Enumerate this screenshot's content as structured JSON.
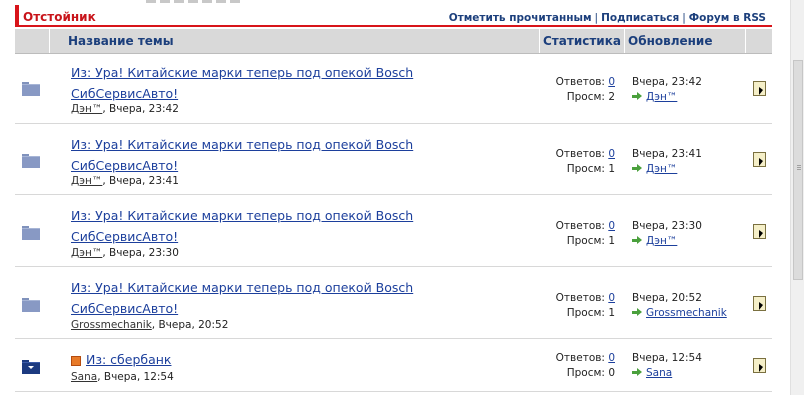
{
  "header": {
    "forum_title": "Отстойник",
    "links": [
      "Отметить прочитанным",
      "Подписаться",
      "Форум в RSS"
    ],
    "separator": "|"
  },
  "columns": {
    "topic": "Название темы",
    "stats": "Статистика",
    "update": "Обновление"
  },
  "labels": {
    "replies": "Ответов:",
    "views": "Просм:"
  },
  "topics": [
    {
      "title_line1": "Из: Ура! Китайские марки теперь под опекой Bosch",
      "title_line2": "СибСервисАвто!",
      "author": "Дэн™",
      "date": ", Вчера, 23:42",
      "replies": "0",
      "views": "2",
      "last_time": "Вчера, 23:42",
      "last_author": "Дэн™",
      "is_new": false,
      "is_hot": false
    },
    {
      "title_line1": "Из: Ура! Китайские марки теперь под опекой Bosch",
      "title_line2": "СибСервисАвто!",
      "author": "Дэн™",
      "date": ", Вчера, 23:41",
      "replies": "0",
      "views": "1",
      "last_time": "Вчера, 23:41",
      "last_author": "Дэн™",
      "is_new": false,
      "is_hot": false
    },
    {
      "title_line1": "Из: Ура! Китайские марки теперь под опекой Bosch",
      "title_line2": "СибСервисАвто!",
      "author": "Дэн™",
      "date": ", Вчера, 23:30",
      "replies": "0",
      "views": "1",
      "last_time": "Вчера, 23:30",
      "last_author": "Дэн™",
      "is_new": false,
      "is_hot": false
    },
    {
      "title_line1": "Из: Ура! Китайские марки теперь под опекой Bosch",
      "title_line2": "СибСервисАвто!",
      "author": "Grossmechanik",
      "date": ", Вчера, 20:52",
      "replies": "0",
      "views": "1",
      "last_time": "Вчера, 20:52",
      "last_author": "Grossmechanik",
      "is_new": false,
      "is_hot": false
    },
    {
      "title_line1": "Из: сбербанк",
      "title_line2": "",
      "author": "Sana",
      "date": ", Вчера, 12:54",
      "replies": "0",
      "views": "0",
      "last_time": "Вчера, 12:54",
      "last_author": "Sana",
      "is_new": true,
      "is_hot": true
    }
  ],
  "icons": {
    "folder": "folder-icon",
    "new_folder": "folder-new-icon",
    "hot": "hot-topic-icon",
    "goto": "go-to-last-post-icon",
    "preview": "topic-preview-icon"
  },
  "colors": {
    "accent_red": "#d8141a",
    "link_blue": "#1c3f9c",
    "header_grey": "#d9d9d9"
  }
}
